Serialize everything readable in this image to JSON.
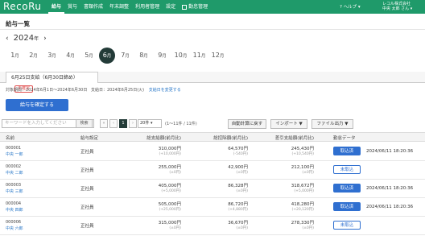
{
  "header": {
    "logo": "RecoRu",
    "nav": [
      {
        "label": "給与",
        "active": true
      },
      {
        "label": "賞与",
        "active": false
      },
      {
        "label": "書類作成",
        "active": false
      },
      {
        "label": "年末調整",
        "active": false
      },
      {
        "label": "利用者管理",
        "active": false
      },
      {
        "label": "設定",
        "active": false
      },
      {
        "label": "勤怠管理",
        "active": false,
        "external": true
      }
    ],
    "help": "? ヘルプ ▾",
    "company": "レコル株式会社",
    "user": "中央 太郎 さん ▾",
    "accent_color": "#1f9a6a"
  },
  "page": {
    "title": "給与一覧"
  },
  "year": {
    "prev": "‹",
    "value": "2024",
    "unit": "年",
    "next": "›"
  },
  "months": [
    {
      "num": "1",
      "unit": "月"
    },
    {
      "num": "2",
      "unit": "月"
    },
    {
      "num": "3",
      "unit": "月"
    },
    {
      "num": "4",
      "unit": "月"
    },
    {
      "num": "5",
      "unit": "月"
    },
    {
      "num": "6",
      "unit": "月",
      "active": true
    },
    {
      "num": "7",
      "unit": "月"
    },
    {
      "num": "8",
      "unit": "月"
    },
    {
      "num": "9",
      "unit": "月"
    },
    {
      "num": "10",
      "unit": "月"
    },
    {
      "num": "11",
      "unit": "月"
    },
    {
      "num": "12",
      "unit": "月"
    }
  ],
  "pay_tab": {
    "label": "6月25日支給（6月30日締め）",
    "badge": "未確定"
  },
  "period": {
    "range": "対象期間：2024年6月1日～2024年6月30日",
    "payday": "支給日：2024年6月25日(火)",
    "link": "支給日を変更する"
  },
  "actions": {
    "confirm": "給与を確定する"
  },
  "toolbar": {
    "search_placeholder": "キーワードを入力してください",
    "search_button": "検索",
    "pager": [
      "«",
      "‹",
      "1",
      "›",
      "»"
    ],
    "per_page": "20件 ▾",
    "count": "(1～11件 / 11件)",
    "recalc": "自動計算に戻す",
    "import": "インポート ▼",
    "export": "ファイル出力 ▼"
  },
  "table": {
    "headers": {
      "name": "名前",
      "type": "給与設定",
      "gross": "総支給額(前月比)",
      "deduction": "総控除額(前月比)",
      "net": "差引支給額(前月比)",
      "status": "勤怠データ"
    },
    "rows": [
      {
        "id": "000001",
        "name": "中央 一郎",
        "type": "正社員",
        "gross": "310,000円",
        "gross_diff": "(+10,000円)",
        "deduction": "64,570円",
        "deduction_diff": "(-540円)",
        "net": "245,430円",
        "net_diff": "(+10,540円)",
        "status": "取込済",
        "status_done": true,
        "time": "2024/06/11 18:20:36"
      },
      {
        "id": "000002",
        "name": "中央 二郎",
        "type": "正社員",
        "gross": "255,000円",
        "gross_diff": "(±0円)",
        "deduction": "42,900円",
        "deduction_diff": "(±0円)",
        "net": "212,100円",
        "net_diff": "(±0円)",
        "status": "未取込",
        "status_done": false,
        "time": ""
      },
      {
        "id": "000003",
        "name": "中央 三郎",
        "type": "正社員",
        "gross": "405,000円",
        "gross_diff": "(+5,000円)",
        "deduction": "86,328円",
        "deduction_diff": "(±0円)",
        "net": "318,672円",
        "net_diff": "(+5,000円)",
        "status": "取込済",
        "status_done": true,
        "time": "2024/06/11 18:20:36"
      },
      {
        "id": "000004",
        "name": "中央 四郎",
        "type": "正社員",
        "gross": "505,000円",
        "gross_diff": "(+25,000円)",
        "deduction": "86,720円",
        "deduction_diff": "(+4,880円)",
        "net": "418,280円",
        "net_diff": "(+20,120円)",
        "status": "取込済",
        "status_done": true,
        "time": "2024/06/11 18:20:36"
      },
      {
        "id": "000006",
        "name": "中央 六郎",
        "type": "正社員",
        "gross": "315,000円",
        "gross_diff": "(±0円)",
        "deduction": "36,670円",
        "deduction_diff": "(±0円)",
        "net": "278,330円",
        "net_diff": "(±0円)",
        "status": "未取込",
        "status_done": false,
        "time": ""
      }
    ]
  }
}
